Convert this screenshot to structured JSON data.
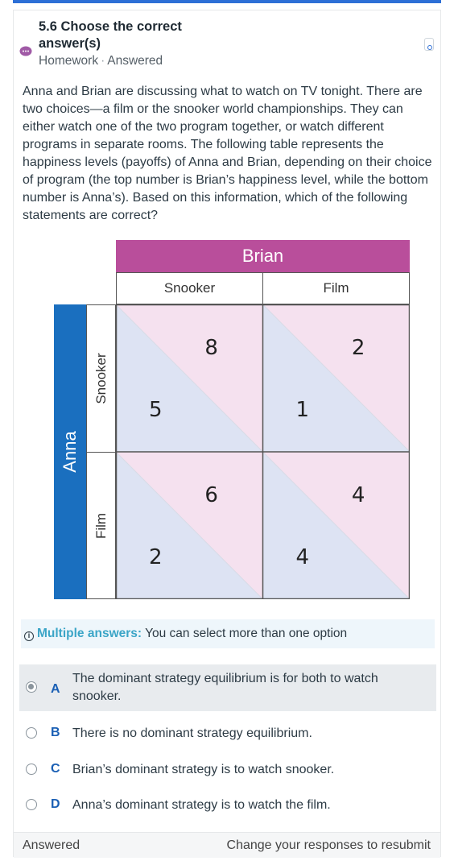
{
  "question": {
    "title": "5.6 Choose the correct answer(s)",
    "status_type": "Homework",
    "status_state": "Answered",
    "prompt": "Anna and Brian are discussing what to watch on TV tonight. There are two choices—a film or the snooker world championships. They can either watch one of the two program together, or watch different programs in separate rooms. The following table represents the happiness levels (payoffs) of Anna and Brian, depending on their choice of program (the top number is Brian’s happiness level, while the bottom number is Anna’s). Based on this information, which of the following statements are correct?"
  },
  "matrix": {
    "column_player": "Brian",
    "row_player": "Anna",
    "columns": [
      "Snooker",
      "Film"
    ],
    "rows": [
      "Snooker",
      "Film"
    ],
    "cells": [
      {
        "row": "Snooker",
        "col": "Snooker",
        "top": "8",
        "bottom": "5"
      },
      {
        "row": "Snooker",
        "col": "Film",
        "top": "2",
        "bottom": "1"
      },
      {
        "row": "Film",
        "col": "Snooker",
        "top": "6",
        "bottom": "2"
      },
      {
        "row": "Film",
        "col": "Film",
        "top": "4",
        "bottom": "4"
      }
    ],
    "colors": {
      "brian_band": "#b94e9b",
      "anna_band": "#1a6fbf",
      "top_triangle": "#f5e1ef",
      "bottom_triangle": "#dde3f3"
    }
  },
  "hint": {
    "strong": "Multiple answers:",
    "text": "You can select more than one option"
  },
  "options": [
    {
      "letter": "A",
      "text": "The dominant strategy equilibrium is for both to watch snooker.",
      "selected": true
    },
    {
      "letter": "B",
      "text": "There is no dominant strategy equilibrium.",
      "selected": false
    },
    {
      "letter": "C",
      "text": "Brian’s dominant strategy is to watch snooker.",
      "selected": false
    },
    {
      "letter": "D",
      "text": "Anna’s dominant strategy is to watch the film.",
      "selected": false
    }
  ],
  "footer": {
    "status": "Answered",
    "action": "Change your responses to resubmit"
  }
}
